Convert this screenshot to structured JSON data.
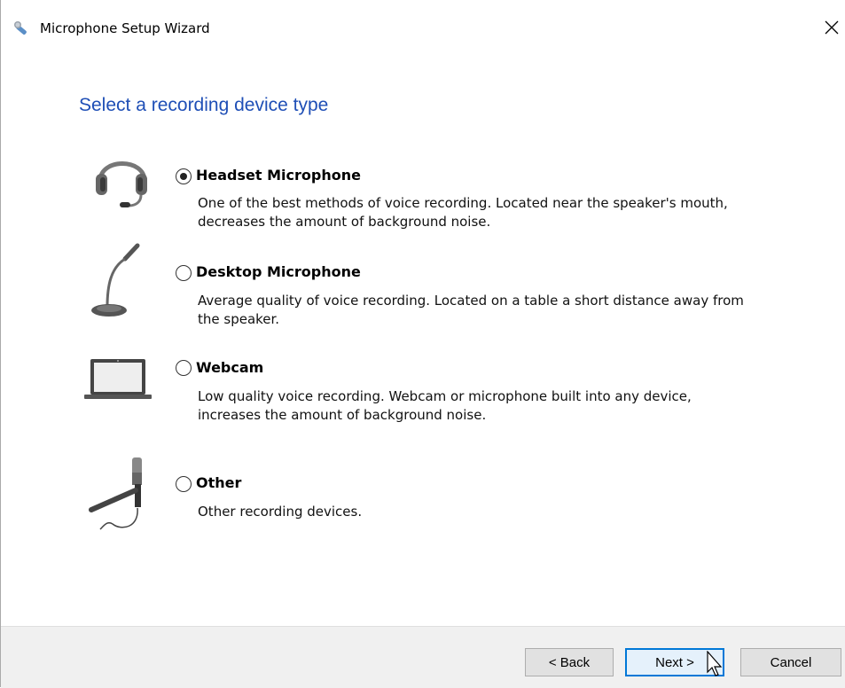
{
  "window": {
    "title": "Microphone Setup Wizard",
    "close_glyph": "✕"
  },
  "page": {
    "heading": "Select a recording device type"
  },
  "options": [
    {
      "label": "Headset Microphone",
      "description_line1": "One of the best methods of voice recording. Located near the speaker's mouth,",
      "description_line2": "decreases the amount of background noise.",
      "selected": true,
      "icon": "headset-icon"
    },
    {
      "label": "Desktop Microphone",
      "description_line1": "Average quality of voice recording. Located on a table a short distance away from",
      "description_line2": "the speaker.",
      "selected": false,
      "icon": "desktop-microphone-icon"
    },
    {
      "label": "Webcam",
      "description_line1": "Low quality voice recording. Webcam or microphone built into any device,",
      "description_line2": "increases the amount of background noise.",
      "selected": false,
      "icon": "laptop-webcam-icon"
    },
    {
      "label": "Other",
      "description_line1": "Other recording devices.",
      "selected": false,
      "icon": "studio-microphone-icon"
    }
  ],
  "buttons": {
    "back": "< Back",
    "next": "Next >",
    "cancel": "Cancel"
  },
  "colors": {
    "heading": "#1f4fb6",
    "primary_border": "#0078d7",
    "footer_bg": "#f0f0f0"
  }
}
